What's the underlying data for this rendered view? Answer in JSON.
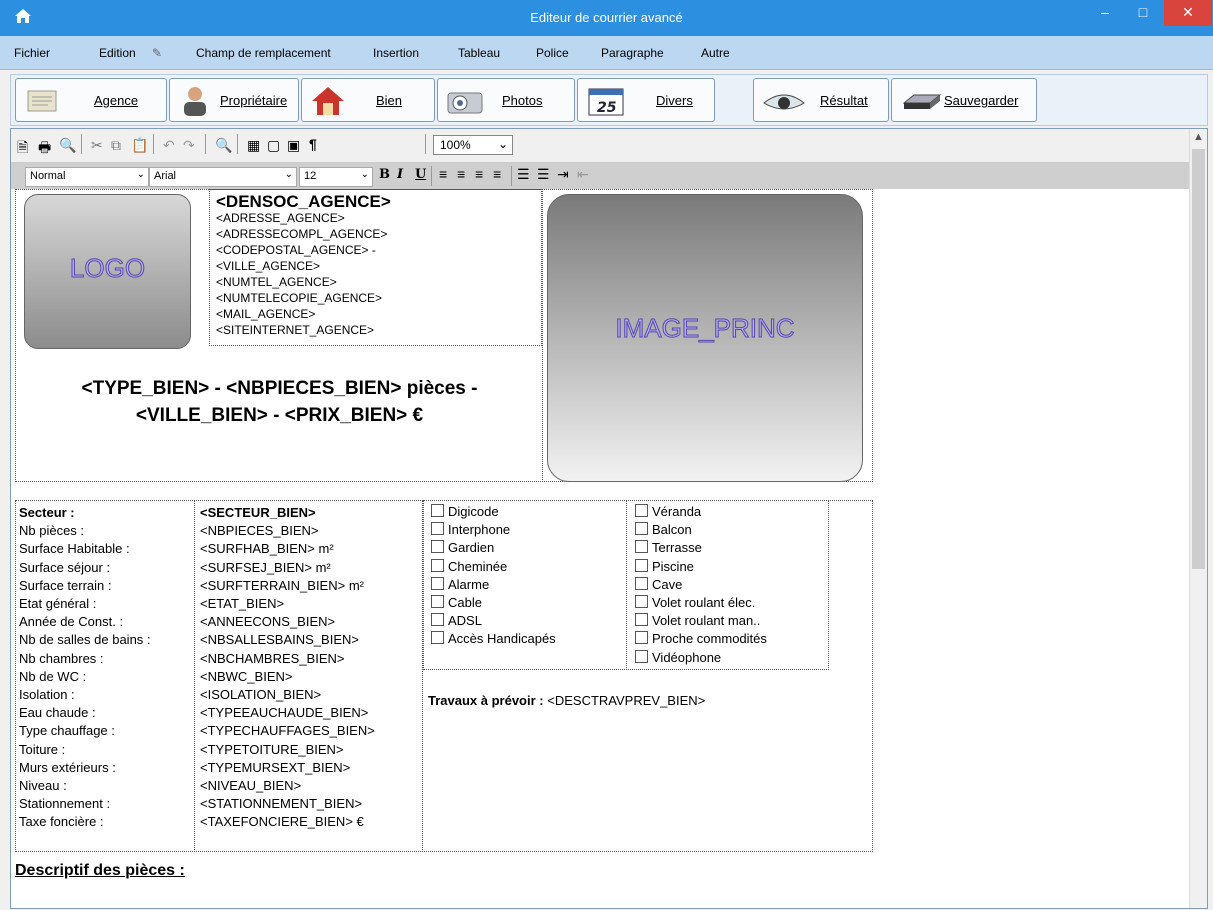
{
  "window": {
    "title": "Editeur de courrier avancé",
    "home_icon": "house-icon"
  },
  "menu": [
    {
      "label": "Fichier"
    },
    {
      "label": "Edition"
    },
    {
      "label": "Champ de remplacement"
    },
    {
      "label": "Insertion"
    },
    {
      "label": "Tableau"
    },
    {
      "label": "Police"
    },
    {
      "label": "Paragraphe"
    },
    {
      "label": "Autre"
    }
  ],
  "nav": {
    "agence": "Agence",
    "proprietaire": "Propriétaire",
    "bien": "Bien",
    "photos": "Photos",
    "divers": "Divers",
    "divers_calendar": "25",
    "resultat": "Résultat",
    "sauvegarder": "Sauvegarder"
  },
  "toolbar": {
    "zoom": "100%",
    "style": "Normal",
    "font": "Arial",
    "size": "12",
    "bold": "B",
    "italic": "I",
    "underline": "U"
  },
  "template": {
    "logo": "LOGO",
    "image_princ": "IMAGE_PRINC",
    "agence_lines": [
      "<DENSOC_AGENCE>",
      "<ADRESSE_AGENCE>",
      "<ADRESSECOMPL_AGENCE>",
      "<CODEPOSTAL_AGENCE> -",
      "<VILLE_AGENCE>",
      "<NUMTEL_AGENCE>",
      "<NUMTELECOPIE_AGENCE>",
      "<MAIL_AGENCE>",
      "<SITEINTERNET_AGENCE>"
    ],
    "headline_1": "<TYPE_BIEN> - <NBPIECES_BIEN> pièces -",
    "headline_2": "<VILLE_BIEN> - <PRIX_BIEN> €",
    "labels": [
      "Secteur :",
      "Nb pièces :",
      "Surface Habitable :",
      "Surface séjour :",
      "Surface terrain :",
      "Etat général :",
      "Année de Const. :",
      "Nb de salles de bains :",
      "Nb chambres :",
      "Nb de WC :",
      "Isolation :",
      "Eau chaude :",
      "Type chauffage :",
      "Toiture :",
      "Murs extérieurs :",
      "Niveau :",
      "Stationnement :",
      "Taxe foncière :"
    ],
    "values": [
      "<SECTEUR_BIEN>",
      "<NBPIECES_BIEN>",
      "<SURFHAB_BIEN> m²",
      "<SURFSEJ_BIEN> m²",
      "<SURFTERRAIN_BIEN> m²",
      "<ETAT_BIEN>",
      "<ANNEECONS_BIEN>",
      "<NBSALLESBAINS_BIEN>",
      "<NBCHAMBRES_BIEN>",
      "<NBWC_BIEN>",
      "<ISOLATION_BIEN>",
      "<TYPEEAUCHAUDE_BIEN>",
      "<TYPECHAUFFAGES_BIEN>",
      "<TYPETOITURE_BIEN>",
      "<TYPEMURSEXT_BIEN>",
      "<NIVEAU_BIEN>",
      "<STATIONNEMENT_BIEN>",
      "<TAXEFONCIERE_BIEN> €"
    ],
    "checks_left": [
      "Digicode",
      "Interphone",
      "Gardien",
      "Cheminée",
      "Alarme",
      "Cable",
      "ADSL",
      "Accès Handicapés"
    ],
    "checks_right": [
      "Véranda",
      "Balcon",
      "Terrasse",
      "Piscine",
      "Cave",
      "Volet roulant élec.",
      "Volet roulant man..",
      "Proche commodités",
      "Vidéophone"
    ],
    "travaux_label": "Travaux à prévoir :",
    "travaux_value": "<DESCTRAVPREV_BIEN>",
    "descriptif": "Descriptif des pièces :"
  }
}
